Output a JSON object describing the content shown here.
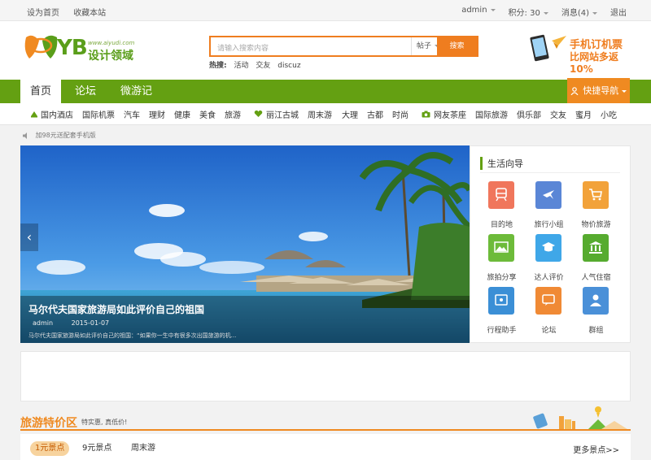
{
  "topbar": {
    "set_home": "设为首页",
    "bookmark": "收藏本站",
    "user": "admin",
    "points": "积分: 30",
    "messages": "消息(4)",
    "logout": "退出"
  },
  "logo": {
    "url": "www.aiyudi.com",
    "name": "设计领域",
    "mark": "YB"
  },
  "search": {
    "placeholder": "请输入搜索内容",
    "category": "帖子",
    "button": "搜索",
    "hot_label": "热搜:",
    "hot_words": [
      "活动",
      "交友",
      "discuz"
    ]
  },
  "promo": {
    "line1": "手机订机票",
    "line2": "比网站多返10%"
  },
  "mainnav": {
    "tabs": [
      "首页",
      "论坛",
      "微游记"
    ],
    "quick": "快捷导航"
  },
  "subnav": [
    "国内酒店",
    "国际机票",
    "汽车",
    "理财",
    "健康",
    "美食",
    "旅游",
    "丽江古城",
    "周末游",
    "大理",
    "古都",
    "时尚",
    "网友茶座",
    "国际旅游",
    "俱乐部",
    "交友",
    "蜜月",
    "小吃"
  ],
  "notice": "加98元送配套手机版",
  "slider": {
    "title": "马尔代夫国家旅游局如此评价自己的祖国",
    "author": "admin",
    "date": "2015-01-07",
    "desc": "马尔代夫国家旅游局如此评价自己的祖国：“如果你一生中有很多次出国旅游的机..."
  },
  "guide": {
    "title": "生活向导",
    "items": [
      {
        "label": "目的地",
        "icon": "train-icon",
        "color": "#f0765c"
      },
      {
        "label": "旅行小组",
        "icon": "airplane-icon",
        "color": "#5a86d6"
      },
      {
        "label": "物价旅游",
        "icon": "cart-icon",
        "color": "#f2a23a"
      },
      {
        "label": "旅拍分享",
        "icon": "photo-icon",
        "color": "#6dbb3a"
      },
      {
        "label": "达人评价",
        "icon": "graduation-cap-icon",
        "color": "#3fa7e8"
      },
      {
        "label": "人气住宿",
        "icon": "building-icon",
        "color": "#56ab2f"
      },
      {
        "label": "行程助手",
        "icon": "assistant-icon",
        "color": "#3b8fd6"
      },
      {
        "label": "论坛",
        "icon": "chat-icon",
        "color": "#f08a35"
      },
      {
        "label": "群组",
        "icon": "user-icon",
        "color": "#4a90d8"
      }
    ]
  },
  "deals": {
    "title": "旅游特价区",
    "subtitle": "特实惠, 真低价!",
    "tabs": [
      "1元景点",
      "9元景点",
      "周末游"
    ],
    "more": "更多景点>>"
  }
}
